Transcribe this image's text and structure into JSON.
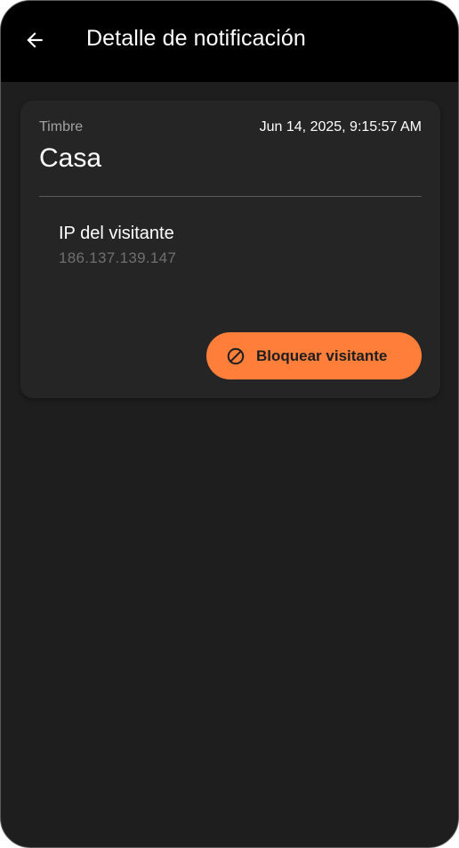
{
  "appbar": {
    "back_icon": "arrow-left-icon",
    "title": "Detalle de notificación"
  },
  "card": {
    "category": "Timbre",
    "timestamp": "Jun 14, 2025, 9:15:57 AM",
    "location": "Casa",
    "ip_label": "IP del visitante",
    "ip_value": "186.137.139.147",
    "block_button": {
      "icon": "block-icon",
      "label": "Bloquear visitante"
    }
  },
  "colors": {
    "appbar_bg": "#000000",
    "screen_bg": "#1e1e1e",
    "card_bg": "#252525",
    "accent": "#ff7f3a",
    "secondary_text": "#a3a3a3",
    "muted_text": "#6f6f6f"
  }
}
